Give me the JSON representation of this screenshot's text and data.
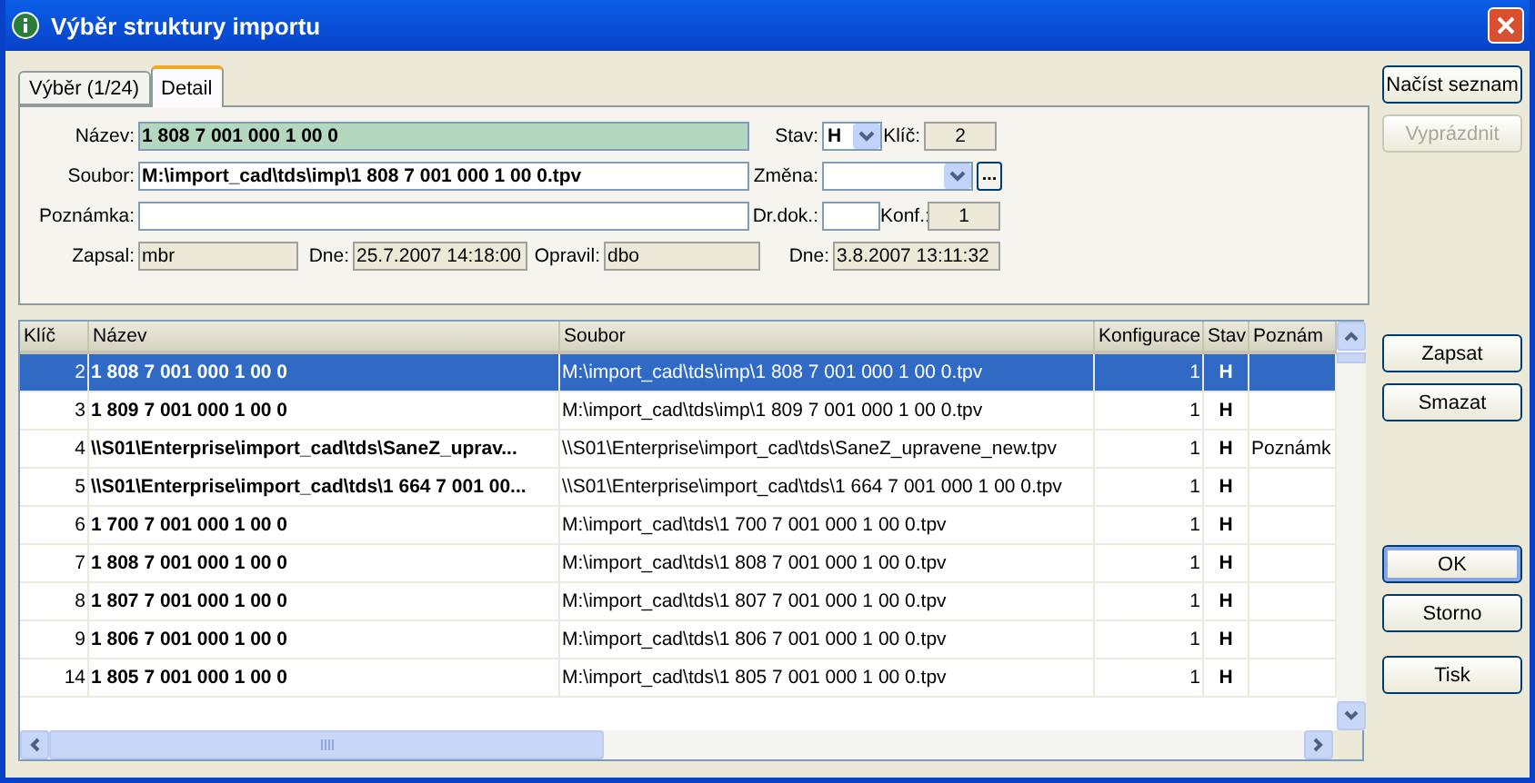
{
  "window": {
    "title": "Výběr struktury importu"
  },
  "tabs": [
    {
      "label": "Výběr (1/24)",
      "selected": false
    },
    {
      "label": "Detail",
      "selected": true
    }
  ],
  "form": {
    "rows": [
      [
        {
          "label": "Název:",
          "value": "1 808 7 001 000 1 00 0",
          "kind": "highlight"
        },
        {
          "label": "Stav:",
          "value": "H",
          "kind": "dropdown"
        },
        {
          "label": "Klíč:",
          "value": "2",
          "kind": "readonly"
        }
      ],
      [
        {
          "label": "Soubor:",
          "value": "M:\\import_cad\\tds\\imp\\1 808 7 001 000 1 00 0.tpv",
          "kind": "text"
        },
        {
          "label": "Změna:",
          "kind": "combo",
          "button": "..."
        }
      ],
      [
        {
          "label": "Poznámka:",
          "kind": "plain"
        },
        {
          "label": "Dr.dok.:",
          "kind": "plain"
        },
        {
          "label": "Konf.:",
          "value": "1",
          "kind": "readonly"
        }
      ],
      [
        {
          "label": "Zapsal:",
          "value": "mbr",
          "kind": "readonly"
        },
        {
          "label": "Dne:",
          "value": "25.7.2007 14:18:00",
          "kind": "readonly"
        },
        {
          "label": "Opravil:",
          "value": "dbo",
          "kind": "readonly"
        },
        {
          "label": "Dne:",
          "value": "3.8.2007 13:11:32",
          "kind": "readonly"
        }
      ]
    ]
  },
  "table": {
    "columns": [
      "Klíč",
      "Název",
      "Soubor",
      "Konfigurace",
      "Stav",
      "Poznám"
    ],
    "rows": [
      {
        "key": "2",
        "name": "1 808 7 001 000 1 00 0",
        "file": "M:\\import_cad\\tds\\imp\\1  808 7 001 000 1 00 0.tpv",
        "config": "1",
        "state": "H",
        "selected": true
      },
      {
        "key": "3",
        "name": "1 809 7 001 000 1 00 0",
        "file": "M:\\import_cad\\tds\\imp\\1  809 7 001 000 1 00 0.tpv",
        "config": "1",
        "state": "H",
        "selected": false
      },
      {
        "key": "4",
        "name": "\\\\S01\\Enterprise\\import_cad\\tds\\SaneZ_uprav...",
        "file": "\\\\S01\\Enterprise\\import_cad\\tds\\SaneZ_upravene_new.tpv",
        "config": "1",
        "state": "H",
        "note": "Poznámk",
        "selected": false
      },
      {
        "key": "5",
        "name": "\\\\S01\\Enterprise\\import_cad\\tds\\1 664 7 001 00...",
        "file": "\\\\S01\\Enterprise\\import_cad\\tds\\1  664 7 001 000 1 00 0.tpv",
        "config": "1",
        "state": "H",
        "selected": false
      },
      {
        "key": "6",
        "name": "1 700 7 001 000 1 00 0",
        "file": "M:\\import_cad\\tds\\1  700 7 001 000 1 00 0.tpv",
        "config": "1",
        "state": "H",
        "selected": false
      },
      {
        "key": "7",
        "name": "1 808 7 001 000 1 00 0",
        "file": "M:\\import_cad\\tds\\1  808 7 001 000 1 00 0.tpv",
        "config": "1",
        "state": "H",
        "selected": false
      },
      {
        "key": "8",
        "name": "1 807 7 001 000 1 00 0",
        "file": "M:\\import_cad\\tds\\1  807 7 001 000 1 00 0.tpv",
        "config": "1",
        "state": "H",
        "selected": false
      },
      {
        "key": "9",
        "name": "1 806 7 001 000 1 00 0",
        "file": "M:\\import_cad\\tds\\1  806 7 001 000 1 00 0.tpv",
        "config": "1",
        "state": "H",
        "selected": false
      },
      {
        "key": "14",
        "name": "1 805 7 001 000 1 00 0",
        "file": "M:\\import_cad\\tds\\1  805 7 001 000 1 00 0.tpv",
        "config": "1",
        "state": "H",
        "selected": false
      }
    ]
  },
  "buttons": [
    [
      {
        "label": "Načíst seznam",
        "disabled": false,
        "default": false
      },
      {
        "label": "Vyprázdnit",
        "disabled": true,
        "default": false
      }
    ],
    [
      {
        "label": "Zapsat",
        "disabled": false,
        "default": false
      },
      {
        "label": "Smazat",
        "disabled": false,
        "default": false
      }
    ],
    [
      {
        "label": "OK",
        "disabled": false,
        "default": true
      },
      {
        "label": "Storno",
        "disabled": false,
        "default": false
      }
    ],
    [
      {
        "label": "Tisk",
        "disabled": false,
        "default": false
      }
    ]
  ]
}
